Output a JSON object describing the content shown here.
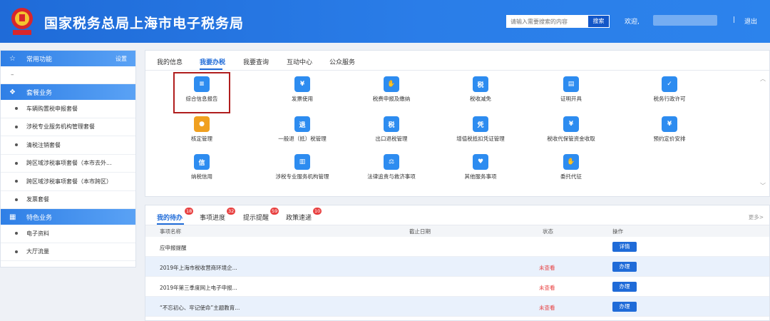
{
  "header": {
    "title": "国家税务总局上海市电子税务局",
    "search_placeholder": "请输入需要搜索的内容",
    "search_button": "搜索",
    "welcome": "欢迎,",
    "separator": "|",
    "logout": "退出"
  },
  "sidebar": {
    "common_title": "常用功能",
    "settings": "设置",
    "dash": "–",
    "package_title": "套餐业务",
    "package_items": [
      "车辆购置税申报套餐",
      "涉税专业服务机构管理套餐",
      "清税注销套餐",
      "跨区域涉税事项套餐（本市去外...",
      "跨区域涉税事项套餐（本市跨区）",
      "发票套餐"
    ],
    "special_title": "特色业务",
    "special_items": [
      "电子资料",
      "大厅流量"
    ]
  },
  "main_tabs": [
    "我的信息",
    "我要办税",
    "我要查询",
    "互动中心",
    "公众服务"
  ],
  "grid": [
    {
      "label": "综合信息报告",
      "icon": "report-icon",
      "color": "#2d8cf0"
    },
    {
      "label": "发票使用",
      "icon": "invoice-icon",
      "color": "#2d8cf0"
    },
    {
      "label": "税费申报及缴纳",
      "icon": "hand-coin-icon",
      "color": "#2d8cf0"
    },
    {
      "label": "税收减免",
      "icon": "tax-reduce-icon",
      "color": "#2d8cf0"
    },
    {
      "label": "证明开具",
      "icon": "certificate-icon",
      "color": "#2d8cf0"
    },
    {
      "label": "税务行政许可",
      "icon": "license-icon",
      "color": "#2d8cf0"
    },
    {
      "label": "核定管理",
      "icon": "approve-icon",
      "color": "#f0a020"
    },
    {
      "label": "一般退（抵）税管理",
      "icon": "refund-icon",
      "color": "#2d8cf0"
    },
    {
      "label": "出口退税管理",
      "icon": "export-refund-icon",
      "color": "#2d8cf0"
    },
    {
      "label": "增值税抵扣凭证管理",
      "icon": "voucher-icon",
      "color": "#2d8cf0"
    },
    {
      "label": "税收代保管资金收取",
      "icon": "deposit-icon",
      "color": "#2d8cf0"
    },
    {
      "label": "预约定价安排",
      "icon": "calendar-icon",
      "color": "#2d8cf0"
    },
    {
      "label": "纳税信用",
      "icon": "credit-icon",
      "color": "#2d8cf0"
    },
    {
      "label": "涉税专业服务机构管理",
      "icon": "agency-icon",
      "color": "#2d8cf0"
    },
    {
      "label": "法律追责与救济事项",
      "icon": "gavel-icon",
      "color": "#2d8cf0"
    },
    {
      "label": "其他服务事项",
      "icon": "heart-hands-icon",
      "color": "#2d8cf0"
    },
    {
      "label": "委托代征",
      "icon": "delegate-icon",
      "color": "#2d8cf0"
    }
  ],
  "todo_tabs": [
    {
      "label": "我的待办",
      "badge": "18"
    },
    {
      "label": "事项进度",
      "badge": "32"
    },
    {
      "label": "提示提醒",
      "badge": "59"
    },
    {
      "label": "政策速递",
      "badge": "10"
    }
  ],
  "more": "更多>",
  "table_headers": [
    "事项名称",
    "截止日期",
    "状态",
    "操作"
  ],
  "rows": [
    {
      "name": "应申报提醒",
      "status": "",
      "action": "详情"
    },
    {
      "name": "2019年上海市税收营商环境企...",
      "status": "未查看",
      "action": "办理"
    },
    {
      "name": "2019年第三季度网上电子申报...",
      "status": "未查看",
      "action": "办理"
    },
    {
      "name": "“不忘初心、牢记使命”主题教育...",
      "status": "未查看",
      "action": "办理"
    }
  ]
}
